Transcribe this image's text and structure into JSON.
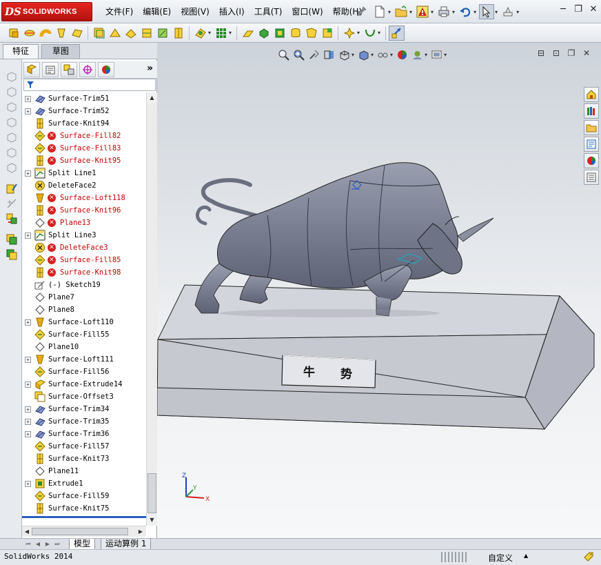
{
  "app": {
    "logo_ds": "DS",
    "logo_text": "SOLIDWORKS"
  },
  "menu": [
    {
      "label": "文件(F)"
    },
    {
      "label": "编辑(E)"
    },
    {
      "label": "视图(V)"
    },
    {
      "label": "插入(I)"
    },
    {
      "label": "工具(T)"
    },
    {
      "label": "窗口(W)"
    },
    {
      "label": "帮助(H)"
    }
  ],
  "panel": {
    "tab_features": "特征",
    "tab_sketch": "草图",
    "more": "»"
  },
  "tree": [
    {
      "label": "Surface-Trim51",
      "icon": "surface-trim-icon",
      "expandable": true,
      "error": false
    },
    {
      "label": "Surface-Trim52",
      "icon": "surface-trim-icon",
      "expandable": true,
      "error": false
    },
    {
      "label": "Surface-Knit94",
      "icon": "surface-knit-icon",
      "expandable": false,
      "error": false
    },
    {
      "label": "Surface-Fill82",
      "icon": "surface-fill-icon",
      "expandable": false,
      "error": true
    },
    {
      "label": "Surface-Fill83",
      "icon": "surface-fill-icon",
      "expandable": false,
      "error": true
    },
    {
      "label": "Surface-Knit95",
      "icon": "surface-knit-icon",
      "expandable": false,
      "error": true
    },
    {
      "label": "Split Line1",
      "icon": "split-line-icon",
      "expandable": true,
      "error": false
    },
    {
      "label": "DeleteFace2",
      "icon": "delete-face-icon",
      "expandable": false,
      "error": false
    },
    {
      "label": "Surface-Loft118",
      "icon": "surface-loft-icon",
      "expandable": false,
      "error": true
    },
    {
      "label": "Surface-Knit96",
      "icon": "surface-knit-icon",
      "expandable": false,
      "error": true
    },
    {
      "label": "Plane13",
      "icon": "plane-icon",
      "expandable": false,
      "error": true
    },
    {
      "label": "Split Line3",
      "icon": "split-line-icon",
      "expandable": true,
      "error": false
    },
    {
      "label": "DeleteFace3",
      "icon": "delete-face-icon",
      "expandable": false,
      "error": true
    },
    {
      "label": "Surface-Fill85",
      "icon": "surface-fill-icon",
      "expandable": false,
      "error": true
    },
    {
      "label": "Surface-Knit98",
      "icon": "surface-knit-icon",
      "expandable": false,
      "error": true
    },
    {
      "label": "(-) Sketch19",
      "icon": "sketch-icon",
      "expandable": false,
      "error": false
    },
    {
      "label": "Plane7",
      "icon": "plane-icon",
      "expandable": false,
      "error": false
    },
    {
      "label": "Plane8",
      "icon": "plane-icon",
      "expandable": false,
      "error": false
    },
    {
      "label": "Surface-Loft110",
      "icon": "surface-loft-icon",
      "expandable": true,
      "error": false
    },
    {
      "label": "Surface-Fill55",
      "icon": "surface-fill-icon",
      "expandable": false,
      "error": false
    },
    {
      "label": "Plane10",
      "icon": "plane-icon",
      "expandable": false,
      "error": false
    },
    {
      "label": "Surface-Loft111",
      "icon": "surface-loft-icon",
      "expandable": true,
      "error": false
    },
    {
      "label": "Surface-Fill56",
      "icon": "surface-fill-icon",
      "expandable": false,
      "error": false
    },
    {
      "label": "Surface-Extrude14",
      "icon": "surface-extrude-icon",
      "expandable": true,
      "error": false
    },
    {
      "label": "Surface-Offset3",
      "icon": "surface-offset-icon",
      "expandable": false,
      "error": false
    },
    {
      "label": "Surface-Trim34",
      "icon": "surface-trim-icon",
      "expandable": true,
      "error": false
    },
    {
      "label": "Surface-Trim35",
      "icon": "surface-trim-icon",
      "expandable": true,
      "error": false
    },
    {
      "label": "Surface-Trim36",
      "icon": "surface-trim-icon",
      "expandable": true,
      "error": false
    },
    {
      "label": "Surface-Fill57",
      "icon": "surface-fill-icon",
      "expandable": false,
      "error": false
    },
    {
      "label": "Surface-Knit73",
      "icon": "surface-knit-icon",
      "expandable": false,
      "error": false
    },
    {
      "label": "Plane11",
      "icon": "plane-icon",
      "expandable": false,
      "error": false
    },
    {
      "label": "Extrude1",
      "icon": "extrude-icon",
      "expandable": true,
      "error": false
    },
    {
      "label": "Surface-Fill59",
      "icon": "surface-fill-icon",
      "expandable": false,
      "error": false
    },
    {
      "label": "Surface-Knit75",
      "icon": "surface-knit-icon",
      "expandable": false,
      "error": false
    }
  ],
  "scene": {
    "plaque_char1": "牛",
    "plaque_char2": "势",
    "triad_x": "X",
    "triad_y": "Y",
    "triad_z": "Z",
    "model_color": "#7d8294",
    "base_top": "#d3d5dc",
    "base_front": "#c4c6cf",
    "base_side": "#b5b7c2"
  },
  "bottom_tabs": {
    "model": "模型",
    "motion": "运动算例 1"
  },
  "status": {
    "text": "SolidWorks 2014",
    "units": "自定义",
    "arrow": "▲"
  },
  "colors": {
    "error_red": "#c40000",
    "accent_blue": "#2a5fc0"
  }
}
